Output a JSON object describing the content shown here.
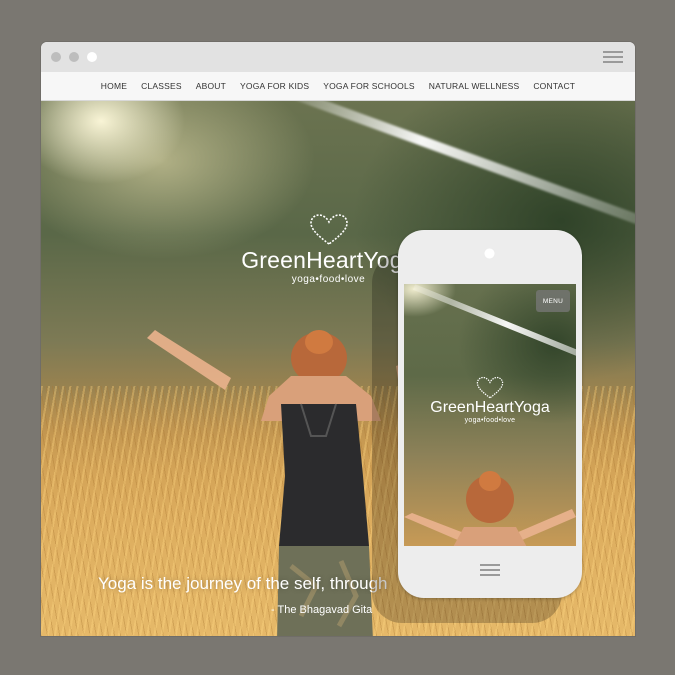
{
  "colors": {
    "page_background": "#7a7771",
    "chrome": "#e2e2e2",
    "nav_background": "#f7f7f7",
    "dot": "#bdbdbd",
    "dot_white": "#ffffff"
  },
  "browser": {
    "window_dots": [
      "dot",
      "dot",
      "dot"
    ],
    "menu_icon": "hamburger-icon"
  },
  "nav": {
    "items": [
      "HOME",
      "CLASSES",
      "ABOUT",
      "YOGA FOR KIDS",
      "YOGA FOR SCHOOLS",
      "NATURAL WELLNESS",
      "CONTACT"
    ]
  },
  "hero": {
    "logo_icon": "heart-icon",
    "logo_title": "GreenHeartYoga",
    "logo_tagline": "yoga•food•love",
    "quote": "Yoga is the journey of the self, through",
    "quote_author": "- The Bhagavad Gita"
  },
  "phone": {
    "menu_button": "MENU",
    "logo_icon": "heart-icon",
    "logo_title": "GreenHeartYoga",
    "logo_tagline": "yoga•food•love",
    "home_icon": "hamburger-icon"
  }
}
